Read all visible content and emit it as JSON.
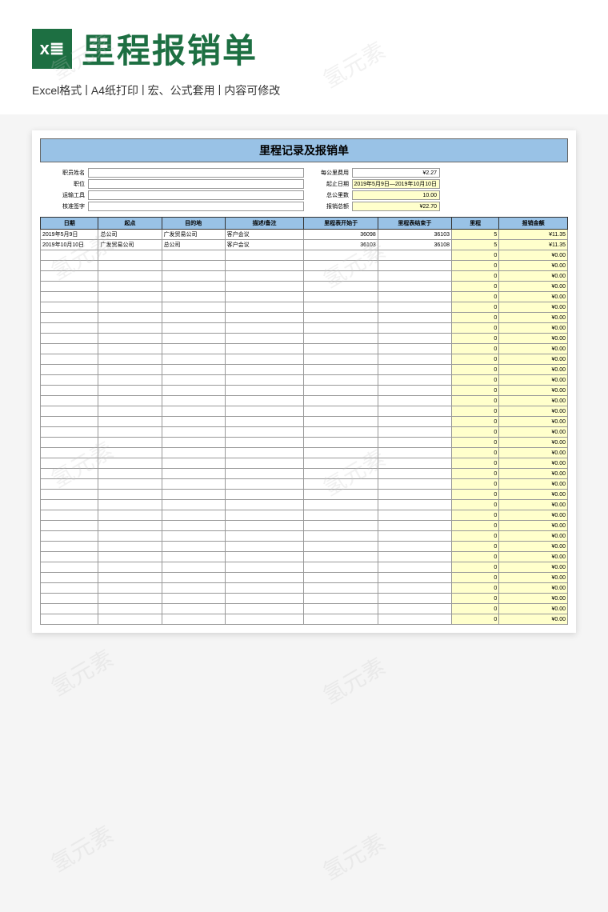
{
  "header": {
    "title": "里程报销单",
    "subtitle_parts": [
      "Excel格式",
      "A4纸打印",
      "宏、公式套用",
      "内容可修改"
    ]
  },
  "sheet": {
    "title": "里程记录及报销单",
    "info_left": [
      {
        "label": "职员姓名",
        "value": ""
      },
      {
        "label": "职位",
        "value": ""
      },
      {
        "label": "运输工具",
        "value": ""
      },
      {
        "label": "核准签字",
        "value": ""
      }
    ],
    "info_right": [
      {
        "label": "每公里费用",
        "value": "¥2.27",
        "yellow": false
      },
      {
        "label": "起止日期",
        "value": "2019年5月9日—2019年10月10日",
        "yellow": true
      },
      {
        "label": "总公里数",
        "value": "10.00",
        "yellow": true
      },
      {
        "label": "报销总额",
        "value": "¥22.70",
        "yellow": true
      }
    ],
    "columns": [
      "日期",
      "起点",
      "目的地",
      "描述/备注",
      "里程表开始于",
      "里程表结束于",
      "里程",
      "报销金额"
    ],
    "rows": [
      {
        "date": "2019年5月9日",
        "start": "总公司",
        "dest": "广发贸易公司",
        "desc": "客户会议",
        "odo1": "36098",
        "odo2": "36103",
        "mile": "5",
        "amt": "¥11.35"
      },
      {
        "date": "2019年10月10日",
        "start": "广发贸易公司",
        "dest": "总公司",
        "desc": "客户会议",
        "odo1": "36103",
        "odo2": "36108",
        "mile": "5",
        "amt": "¥11.35"
      }
    ],
    "empty_row": {
      "mile": "0",
      "amt": "¥0.00"
    },
    "empty_count": 36
  },
  "watermark_text": "氢元素"
}
